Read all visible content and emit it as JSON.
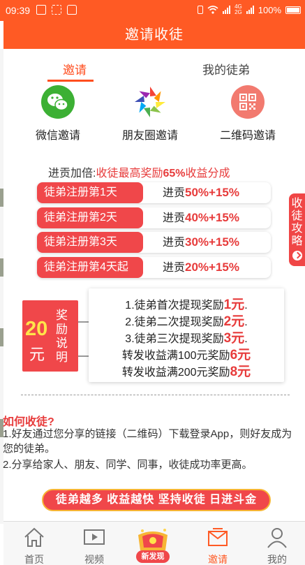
{
  "status_bar": {
    "time": "09:39",
    "network_top": "4G",
    "network_bottom": "2G",
    "battery": "100%"
  },
  "header": {
    "title": "邀请收徒"
  },
  "tabs": [
    {
      "label": "邀请",
      "active": true
    },
    {
      "label": "我的徒弟",
      "active": false
    }
  ],
  "share": [
    {
      "label": "微信邀请",
      "icon": "wechat-icon"
    },
    {
      "label": "朋友圈邀请",
      "icon": "moments-icon"
    },
    {
      "label": "二维码邀请",
      "icon": "qrcode-icon"
    }
  ],
  "bonus": {
    "prefix": "进贡加倍:",
    "highlight": "收徒最高奖励",
    "percent": "65%",
    "suffix": "收益分成",
    "rows": [
      {
        "day": "徒弟注册第1天",
        "label": "进贡",
        "value": "50%+15%"
      },
      {
        "day": "徒弟注册第2天",
        "label": "进贡",
        "value": "40%+15%"
      },
      {
        "day": "徒弟注册第3天",
        "label": "进贡",
        "value": "30%+15%"
      },
      {
        "day": "徒弟注册第4天起",
        "label": "进贡",
        "value": "20%+15%"
      }
    ]
  },
  "side_tab": {
    "label": "收徒攻略"
  },
  "reward": {
    "amount": "20",
    "unit": "元",
    "title": "奖励说明",
    "lines": [
      {
        "text": "1.徒弟首次提现奖励",
        "amount": "1元",
        "end": "."
      },
      {
        "text": "2.徒弟二次提现奖励",
        "amount": "2元",
        "end": "."
      },
      {
        "text": "3.徒弟三次提现奖励",
        "amount": "3元",
        "end": "."
      },
      {
        "text": "转发收益满100元奖励",
        "amount": "6元",
        "end": ""
      },
      {
        "text": "转发收益满200元奖励",
        "amount": "8元",
        "end": ""
      }
    ]
  },
  "howto": {
    "title": "如何收徒?",
    "p1": "1.好友通过您分享的链接（二维码）下载登录App，则好友成为您的徒弟。",
    "p2": "2.分享给家人、朋友、同学、同事，收徒成功率更高。"
  },
  "slogan": "徒弟越多  收益越快  坚持收徒  日进斗金",
  "bottom_nav": [
    {
      "label": "首页",
      "icon": "home-icon",
      "active": false
    },
    {
      "label": "视频",
      "icon": "video-icon",
      "active": false
    },
    {
      "label": "新发现",
      "icon": "discover-icon",
      "active": false
    },
    {
      "label": "邀请",
      "icon": "invite-mail-icon",
      "active": true
    },
    {
      "label": "我的",
      "icon": "profile-icon",
      "active": false
    }
  ],
  "colors": {
    "brand": "#ff5a24",
    "accent_red": "#f0474a",
    "highlight": "#e73b3b",
    "gold": "#ffe54a"
  }
}
